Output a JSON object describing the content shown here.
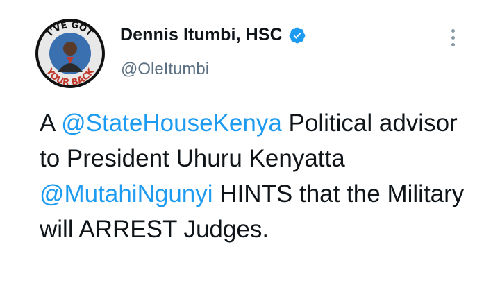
{
  "author": {
    "display_name": "Dennis Itumbi, HSC",
    "handle": "@OleItumbi",
    "avatar_text_top": "I'VE GOT",
    "avatar_text_bottom": "YOUR BACK",
    "verified_icon": "verified-badge-icon"
  },
  "menu": {
    "icon": "more-vertical-icon"
  },
  "tweet": {
    "segments": [
      {
        "type": "text",
        "value": "A "
      },
      {
        "type": "mention",
        "value": "@StateHouseKenya"
      },
      {
        "type": "text",
        "value": " Political advisor to President Uhuru Kenyatta "
      },
      {
        "type": "mention",
        "value": "@MutahiNgunyi"
      },
      {
        "type": "text",
        "value": " HINTS that the Military will ARREST Judges."
      }
    ]
  },
  "colors": {
    "mention": "#1d9bf0",
    "verified": "#1d9bf0",
    "text": "#0f1419",
    "handle": "#5b7083",
    "background": "#ffffff"
  }
}
